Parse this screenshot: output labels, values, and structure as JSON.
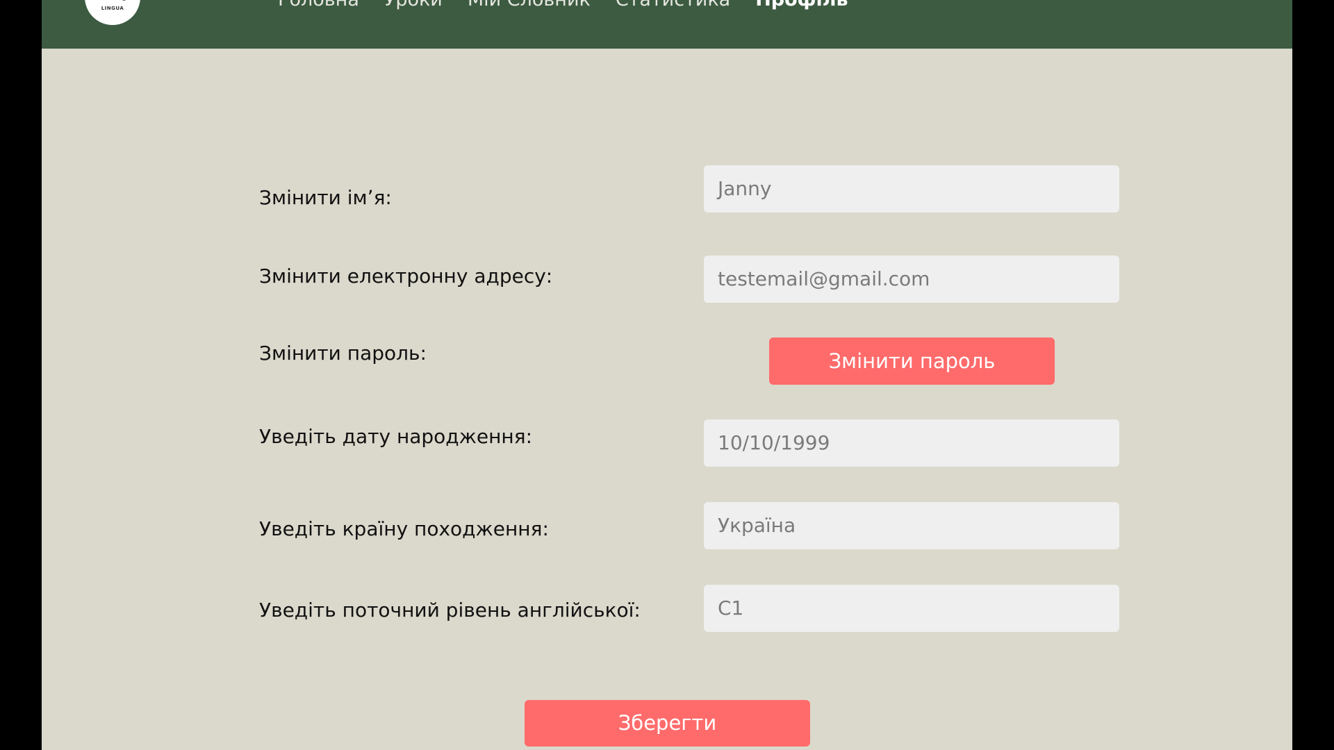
{
  "colors": {
    "navbar": "#3c5b41",
    "page_background": "#dbd9cc",
    "field_background": "#efefef",
    "accent_button": "#ff6b6b"
  },
  "logo": {
    "text": "LINGUA",
    "icon": "computer-mouse-icon"
  },
  "nav": {
    "items": [
      {
        "label": "Головна",
        "active": false
      },
      {
        "label": "Уроки",
        "active": false
      },
      {
        "label": "Мій Словник",
        "active": false
      },
      {
        "label": "Статистика",
        "active": false
      },
      {
        "label": "Профіль",
        "active": true
      }
    ]
  },
  "form": {
    "name": {
      "label": "Змінити імʼя:",
      "value": "Janny"
    },
    "email": {
      "label": "Змінити електронну адресу:",
      "value": "testemail@gmail.com"
    },
    "password": {
      "label": "Змінити пароль:",
      "button_label": "Змінити пароль"
    },
    "birthdate": {
      "label": "Уведіть дату народження:",
      "value": "10/10/1999"
    },
    "country": {
      "label": "Уведіть країну походження:",
      "value": "Україна"
    },
    "english_level": {
      "label": "Уведіть поточний рівень англійської:",
      "value": "C1"
    },
    "save_label": "Зберегти"
  }
}
